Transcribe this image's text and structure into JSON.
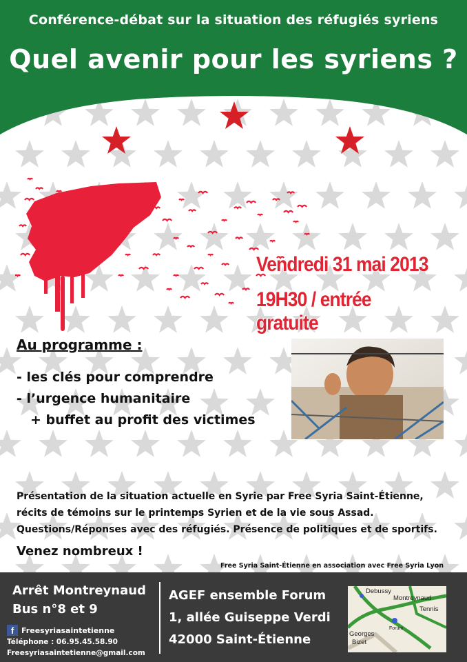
{
  "header": {
    "subtitle": "Conférence-débat sur la situation des réfugiés syriens",
    "title": "Quel avenir pour les syriens ?",
    "green_color": "#1c7e3c",
    "star_color": "#d42026"
  },
  "event": {
    "date": "Vendredi 31 mai 2013",
    "time_entry": "19H30 / entrée gratuite",
    "accent_color": "#e02433"
  },
  "programme": {
    "heading": "Au programme :",
    "items": [
      "- les clés pour comprendre",
      "- l’urgence humanitaire",
      "+ buffet au profit des victimes"
    ]
  },
  "description": {
    "lines": [
      "Présentation de la situation actuelle en Syrie par Free Syria Saint-Étienne,",
      "récits de témoins sur le printemps Syrien et de la vie sous Assad.",
      "Questions/Réponses avec des réfugiés. Présence de politiques et de sportifs."
    ],
    "call_to_action": "Venez nombreux !",
    "association": "Free Syria Saint-Étienne en association avec Free Syria Lyon"
  },
  "footer": {
    "transport_line1": "Arrêt Montreynaud",
    "transport_line2": "Bus n°8 et 9",
    "facebook_icon": "facebook-icon",
    "facebook": "Freesyriasaintetienne",
    "phone": "Téléphone : 06.95.45.58.90",
    "email": "Freesyriasaintetienne@gmail.com",
    "venue_name": "AGEF ensemble Forum",
    "venue_street": "1, allée Guiseppe Verdi",
    "venue_city": "42000 Saint-Étienne",
    "map_labels": [
      "Debussy",
      "Montreynaud",
      "Tennis",
      "Forum",
      "Georges",
      "Bizet"
    ]
  }
}
